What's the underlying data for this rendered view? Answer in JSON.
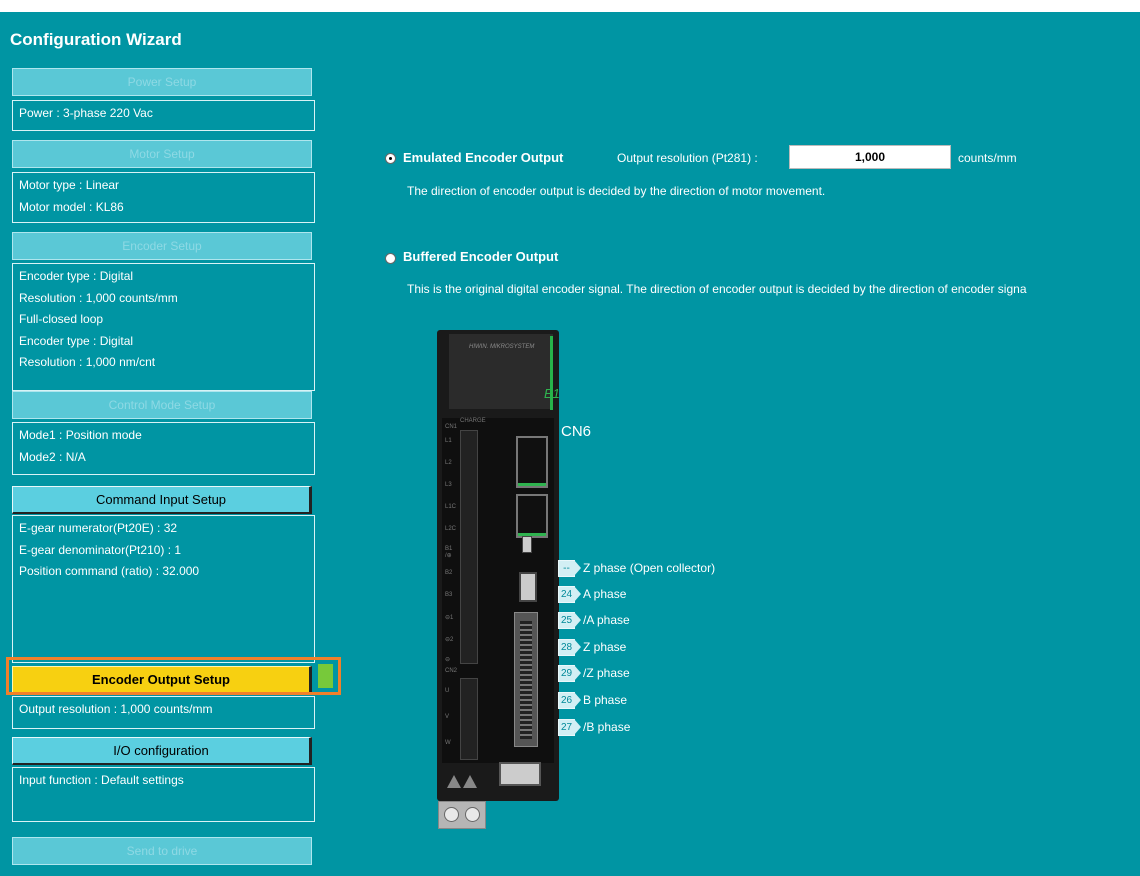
{
  "app": {
    "title": "Configuration Wizard"
  },
  "sidebar": {
    "power": {
      "label": "Power Setup",
      "info": [
        "Power : 3-phase 220 Vac"
      ]
    },
    "motor": {
      "label": "Motor Setup",
      "info": [
        "Motor type : Linear",
        "Motor model  : KL86"
      ]
    },
    "encoder": {
      "label": "Encoder Setup",
      "info": [
        "Encoder type : Digital",
        "Resolution : 1,000 counts/mm",
        "Full-closed loop",
        "Encoder type : Digital",
        "Resolution : 1,000 nm/cnt"
      ]
    },
    "control_mode": {
      "label": "Control Mode Setup",
      "info": [
        "Mode1 : Position mode",
        "Mode2 : N/A"
      ]
    },
    "command_input": {
      "label": "Command Input Setup",
      "info": [
        "E-gear numerator(Pt20E) : 32",
        "E-gear denominator(Pt210) : 1",
        "Position command (ratio) : 32.000"
      ]
    },
    "encoder_output": {
      "label": "Encoder Output Setup",
      "info": [
        "Output resolution : 1,000 counts/mm"
      ]
    },
    "io": {
      "label": "I/O configuration",
      "info": [
        "Input function : Default settings"
      ]
    },
    "send": {
      "label": "Send to drive"
    }
  },
  "main": {
    "emulated": {
      "label": "Emulated Encoder Output",
      "selected": true,
      "resolution_label": "Output resolution (Pt281) :",
      "resolution_value": "1,000",
      "unit": "counts/mm",
      "description": "The direction of encoder output is decided by the direction of motor movement."
    },
    "buffered": {
      "label": "Buffered Encoder Output",
      "selected": false,
      "description": "This is the original digital encoder signal. The direction of encoder output is decided by the direction of encoder signa"
    },
    "drive": {
      "brand": "HIWIN. MIKROSYSTEM",
      "model": "E1",
      "charge": "CHARGE",
      "cn1": "CN1",
      "cn2": "CN2",
      "terminals": [
        "L1",
        "L2",
        "L3",
        "L1C",
        "L2C",
        "B1 /⊕",
        "B2",
        "B3",
        "⊖1",
        "⊖2",
        "⊖"
      ],
      "motor_terminals": [
        "U",
        "V",
        "W"
      ],
      "connector_label": "CN6",
      "pins": [
        {
          "num": "--",
          "label": "Z phase (Open collector)"
        },
        {
          "num": "24",
          "label": "A phase"
        },
        {
          "num": "25",
          "label": "/A phase"
        },
        {
          "num": "28",
          "label": "Z phase"
        },
        {
          "num": "29",
          "label": "/Z phase"
        },
        {
          "num": "26",
          "label": "B phase"
        },
        {
          "num": "27",
          "label": "/B phase"
        }
      ]
    }
  },
  "colors": {
    "background": "#0095a3",
    "current_step": "#f7d011",
    "highlight_border": "#f0802a",
    "step_button": "#5ac8d6"
  }
}
